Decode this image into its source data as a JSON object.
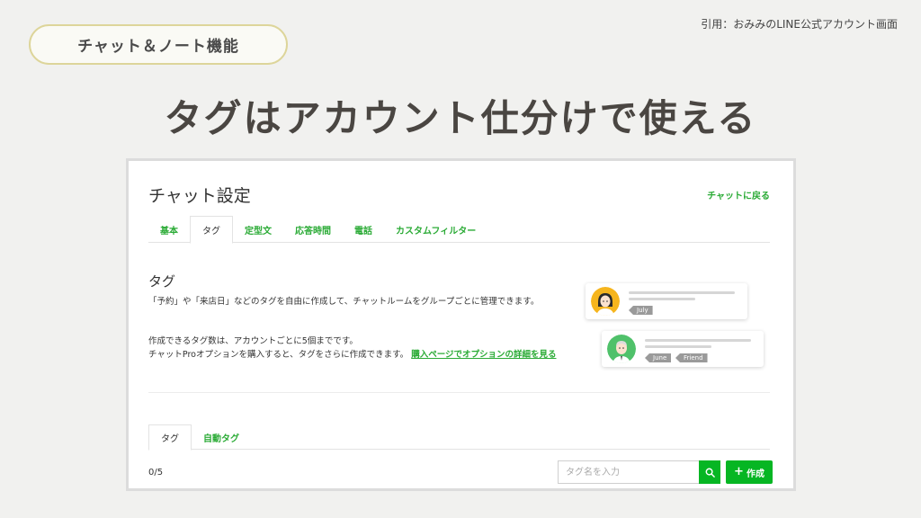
{
  "slide": {
    "citation": "引用：おみみのLINE公式アカウント画面",
    "category_pill": "チャット＆ノート機能",
    "headline": "タグはアカウント仕分けで使える"
  },
  "panel": {
    "title": "チャット設定",
    "back_link": "チャットに戻る",
    "tabs": [
      {
        "label": "基本",
        "active": false
      },
      {
        "label": "タグ",
        "active": true
      },
      {
        "label": "定型文",
        "active": false
      },
      {
        "label": "応答時間",
        "active": false
      },
      {
        "label": "電話",
        "active": false
      },
      {
        "label": "カスタムフィルター",
        "active": false
      }
    ],
    "section_title": "タグ",
    "description1": "「予約」や「来店日」などのタグを自由に作成して、チャットルームをグループごとに管理できます。",
    "description2_line1": "作成できるタグ数は、アカウントごとに5個までです。",
    "description2_line2": "チャットProオプションを購入すると、タグをさらに作成できます。",
    "description2_link": "購入ページでオプションの詳細を見る",
    "illustration": {
      "card1_tags": [
        "July"
      ],
      "card2_tags": [
        "June",
        "Friend"
      ]
    },
    "sub_tabs": [
      {
        "label": "タグ",
        "active": true
      },
      {
        "label": "自動タグ",
        "active": false
      }
    ],
    "count": "0/5",
    "search": {
      "placeholder": "タグ名を入力"
    },
    "create_button": "作成",
    "colors": {
      "accent": "#06b623",
      "link": "#2bab36"
    }
  }
}
